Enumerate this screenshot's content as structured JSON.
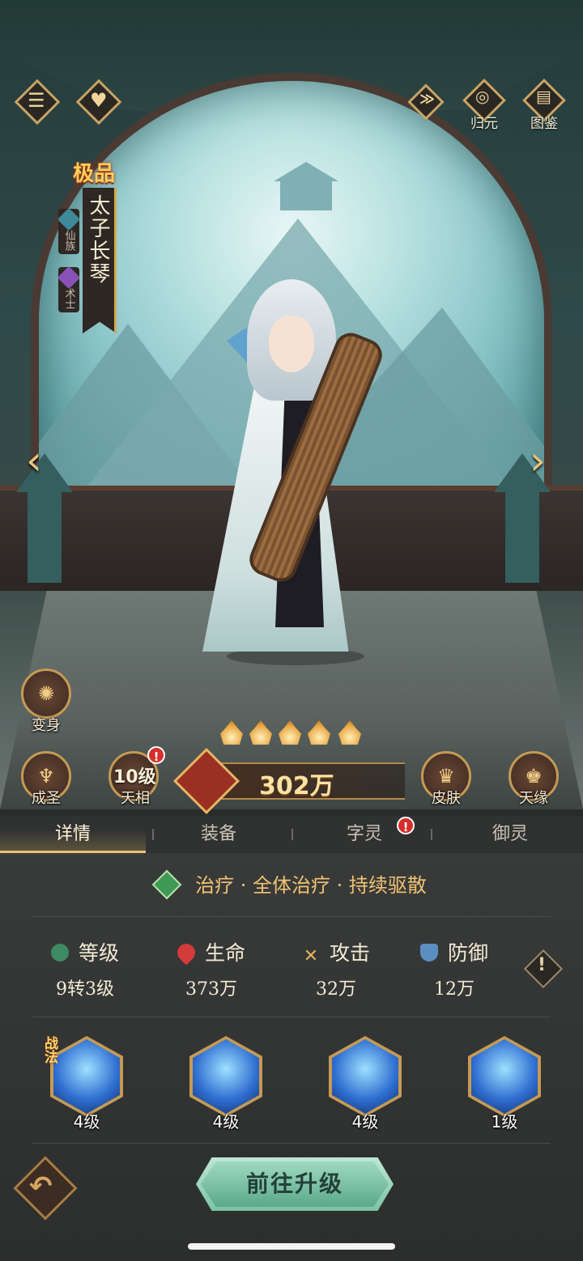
{
  "top_bar": {
    "menu_icon": "menu-icon",
    "favorite_icon": "heart-icon",
    "share_icon": "share-icon",
    "guiyuan_label": "归元",
    "tujian_label": "图鉴"
  },
  "hero": {
    "quality": "极品",
    "name": "太子长琴",
    "race_tag": "仙族",
    "class_tag": "术士"
  },
  "actions": {
    "transform_label": "变身",
    "chengsheng_label": "成圣",
    "tianxiang_level": "10级",
    "tianxiang_label": "天相",
    "power": "302万",
    "skin_label": "皮肤",
    "fate_label": "天缘"
  },
  "stars": 5,
  "tabs": [
    "详情",
    "装备",
    "字灵",
    "御灵"
  ],
  "role": "治疗 · 全体治疗 · 持续驱散",
  "stats": [
    {
      "name": "等级",
      "value": "9转3级"
    },
    {
      "name": "生命",
      "value": "373万"
    },
    {
      "name": "攻击",
      "value": "32万"
    },
    {
      "name": "防御",
      "value": "12万"
    }
  ],
  "skills": [
    {
      "tag": "战法",
      "level": "4级"
    },
    {
      "tag": "",
      "level": "4级"
    },
    {
      "tag": "",
      "level": "4级"
    },
    {
      "tag": "",
      "level": "1级"
    }
  ],
  "upgrade_button": "前往升级",
  "colors": {
    "gold": "#e8c27a",
    "accent_green": "#7cc3a8",
    "alert_red": "#d62e2a"
  }
}
